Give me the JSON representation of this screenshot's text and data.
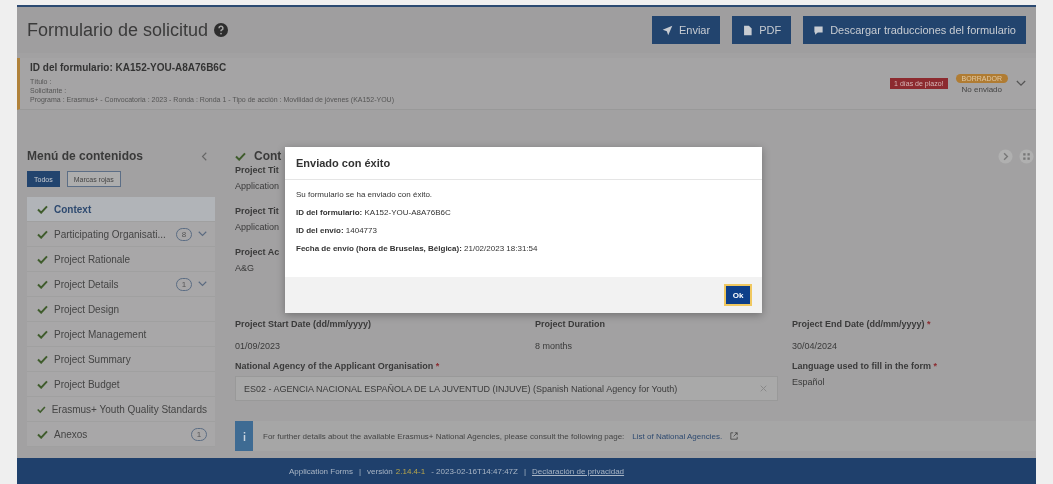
{
  "header": {
    "title": "Formulario de solicitud",
    "buttons": [
      {
        "kind": "send",
        "label": "Enviar"
      },
      {
        "kind": "file",
        "label": "PDF"
      },
      {
        "kind": "comment",
        "label": "Descargar traducciones del formulario"
      }
    ]
  },
  "form_card": {
    "id_line": "ID del formulario: KA152-YOU-A8A76B6C",
    "lines": [
      "Título :",
      "Solicitante :",
      "Programa : Erasmus+ - Convocatoria : 2023 - Ronda : Ronda 1 - Tipo de acción : Movilidad de jóvenes (KA152-YOU)"
    ],
    "deadline_badge": "1 días de plazo!",
    "status_badge": "BORRADOR",
    "status_text": "No enviado"
  },
  "sidebar": {
    "title": "Menú de contenidos",
    "filters": [
      {
        "label": "Todos",
        "selected": true
      },
      {
        "label": "Marcas rojas",
        "selected": false
      }
    ],
    "items": [
      {
        "label": "Context",
        "selected": true,
        "expandable": false
      },
      {
        "label": "Participating Organisati...",
        "selected": false,
        "count": "8",
        "expandable": true
      },
      {
        "label": "Project Rationale",
        "selected": false,
        "expandable": false
      },
      {
        "label": "Project Details",
        "selected": false,
        "count": "1",
        "expandable": true
      },
      {
        "label": "Project Design",
        "selected": false,
        "expandable": false
      },
      {
        "label": "Project Management",
        "selected": false,
        "expandable": false
      },
      {
        "label": "Project Summary",
        "selected": false,
        "expandable": false
      },
      {
        "label": "Project Budget",
        "selected": false,
        "expandable": false
      },
      {
        "label": "Erasmus+ Youth Quality Standards",
        "selected": false,
        "expandable": false
      },
      {
        "label": "Anexos",
        "selected": false,
        "count": "1",
        "expandable": false
      }
    ]
  },
  "content": {
    "section_title": "Cont",
    "partial_fields": [
      {
        "label": "Project Tit",
        "value": "Application"
      },
      {
        "label": "Project Tit",
        "value": "Application"
      },
      {
        "label": "Project Ac",
        "value": "A&G"
      }
    ],
    "fields": [
      {
        "label": "Project Start Date (dd/mm/yyyy)",
        "value": "01/09/2023"
      },
      {
        "label": "Project Duration",
        "value": "8 months"
      },
      {
        "label": "Project End Date (dd/mm/yyyy)",
        "required_mark": "*",
        "value": "30/04/2024"
      }
    ],
    "agency": {
      "label": "National Agency of the Applicant Organisation",
      "required_mark": "*",
      "value": "ES02 - AGENCIA NACIONAL ESPAÑOLA DE LA JUVENTUD (INJUVE) (Spanish National Agency for Youth)"
    },
    "language": {
      "label": "Language used to fill in the form",
      "required_mark": "*",
      "value": "Español"
    },
    "info": {
      "text": "For further details about the available Erasmus+ National Agencies, please consult the following page:",
      "link": "List of National Agencies."
    }
  },
  "dialog": {
    "title": "Enviado con éxito",
    "message": "Su formulario se ha enviado con éxito.",
    "details": [
      {
        "label": "ID del formulario:",
        "value": "KA152-YOU-A8A76B6C"
      },
      {
        "label": "ID del envío:",
        "value": "1404773"
      },
      {
        "label": "Fecha de envío (hora de Bruselas, Bélgica):",
        "value": "21/02/2023 18:31:54"
      }
    ],
    "ok": "Ok"
  },
  "footer": {
    "app": "Application Forms",
    "version_label": "versión",
    "version": "2.14.4-1",
    "date": "- 2023-02-16T14:47:47Z",
    "sep": "|",
    "privacy": "Declaración de privacidad"
  }
}
